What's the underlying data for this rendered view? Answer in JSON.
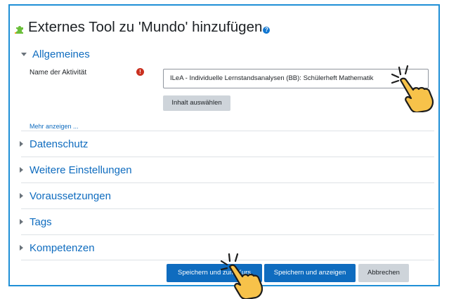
{
  "header": {
    "title": "Externes Tool zu 'Mundo' hinzufügen",
    "help_icon": "?"
  },
  "sections": {
    "general": {
      "title": "Allgemeines",
      "activity_name_label": "Name der Aktivität",
      "required_icon": "!",
      "activity_name_value": "ILeA - Individuelle Lernstandsanalysen (BB): Schülerheft Mathematik",
      "select_content_button": "Inhalt auswählen",
      "show_more_link": "Mehr anzeigen ..."
    },
    "collapsed": [
      "Datenschutz",
      "Weitere Einstellungen",
      "Voraussetzungen",
      "Tags",
      "Kompetenzen"
    ]
  },
  "footer": {
    "save_return": "Speichern und zum Kurs",
    "save_display": "Speichern und anzeigen",
    "cancel": "Abbrechen"
  },
  "colors": {
    "accent": "#0f6cbf",
    "frame_border": "#1f8fd6",
    "required": "#ca3120",
    "puzzle": "#6bbf3a",
    "hand": "#f7c24a"
  },
  "icons": [
    "puzzle-icon",
    "help-icon",
    "required-icon",
    "chevron-down-icon",
    "chevron-right-icon",
    "pointing-hand-icon"
  ]
}
